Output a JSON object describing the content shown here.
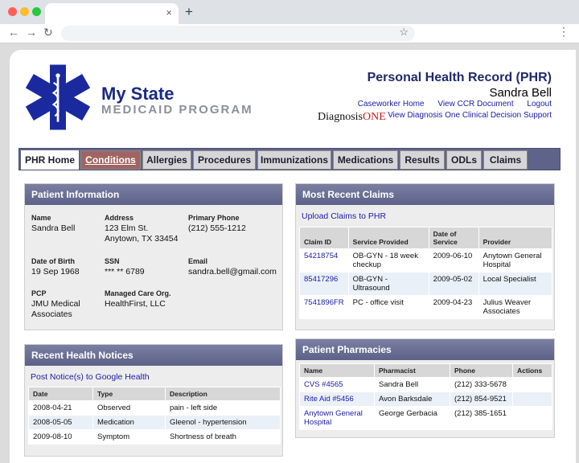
{
  "browser": {
    "tab_close": "×",
    "new_tab": "+",
    "back": "←",
    "forward": "→",
    "reload": "↻",
    "star": "☆",
    "menu": "⋮"
  },
  "header": {
    "logo_title": "My State",
    "logo_subtitle": "MEDICAID PROGRAM",
    "title": "Personal Health Record (PHR)",
    "user_name": "Sandra Bell",
    "links": [
      "Caseworker Home",
      "View CCR Document",
      "Logout"
    ],
    "dx_brand_a": "Diagnosis",
    "dx_brand_b": "ONE",
    "decision_support_link": "View Diagnosis One Clinical Decision Support"
  },
  "tabs": [
    "PHR Home",
    "Conditions",
    "Allergies",
    "Procedures",
    "Immunizations",
    "Medications",
    "Results",
    "ODLs",
    "Claims"
  ],
  "patient_info": {
    "title": "Patient Information",
    "name_label": "Name",
    "name": "Sandra Bell",
    "address_label": "Address",
    "address1": "123 Elm St.",
    "address2": "Anytown, TX 33454",
    "phone_label": "Primary Phone",
    "phone": "(212) 555-1212",
    "dob_label": "Date of Birth",
    "dob": "19 Sep 1968",
    "ssn_label": "SSN",
    "ssn": "*** ** 6789",
    "email_label": "Email",
    "email": "sandra.bell@gmail.com",
    "pcp_label": "PCP",
    "pcp1": "JMU Medical",
    "pcp2": "Associates",
    "mco_label": "Managed Care Org.",
    "mco": "HealthFirst, LLC"
  },
  "health_notices": {
    "title": "Recent Health Notices",
    "post_link": "Post Notice(s) to Google Health",
    "headers": [
      "Date",
      "Type",
      "Description"
    ],
    "rows": [
      [
        "2008-04-21",
        "Observed",
        "pain - left side"
      ],
      [
        "2008-05-05",
        "Medication",
        "Gleenol - hypertension"
      ],
      [
        "2009-08-10",
        "Symptom",
        "Shortness of breath"
      ]
    ]
  },
  "claims": {
    "title": "Most Recent Claims",
    "upload_link": "Upload Claims to PHR",
    "headers": [
      "Claim ID",
      "Service Provided",
      "Date of Service",
      "Provider"
    ],
    "rows": [
      [
        "54218754",
        "OB-GYN - 18 week checkup",
        "2009-06-10",
        "Anytown General Hospital"
      ],
      [
        "85417296",
        "OB-GYN - Ultrasound",
        "2009-05-02",
        "Local Specialist"
      ],
      [
        "7541896FR",
        "PC - office visit",
        "2009-04-23",
        "Julius Weaver Associates"
      ]
    ]
  },
  "pharmacies": {
    "title": "Patient Pharmacies",
    "headers": [
      "Name",
      "Pharmacist",
      "Phone",
      "Actions"
    ],
    "rows": [
      [
        "CVS #4565",
        "Sandra Bell",
        "(212) 333-5678",
        ""
      ],
      [
        "Rite Aid #5456",
        "Avon Barksdale",
        "(212) 854-9521",
        ""
      ],
      [
        "Anytown General Hospital",
        "George Gerbacia",
        "(212) 385-1651",
        ""
      ]
    ]
  },
  "colors": {
    "nav_bar": "#5f638a",
    "panel_header": "#6a6e95",
    "active_tab": "#a06563",
    "link": "#1a1aa8",
    "logo_blue": "#1a2a9e"
  }
}
